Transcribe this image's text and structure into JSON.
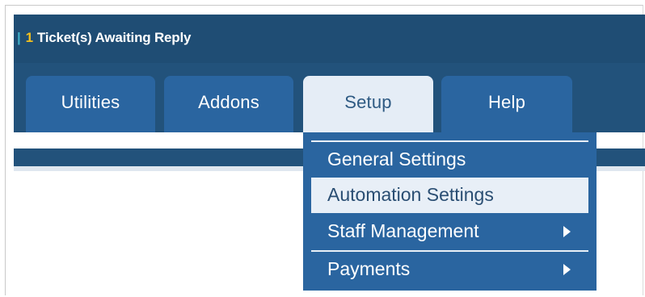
{
  "header": {
    "notice_separator": "|",
    "ticket_count": "1",
    "ticket_label": "Ticket(s) Awaiting Reply"
  },
  "tabs": [
    {
      "label": "Utilities",
      "active": false
    },
    {
      "label": "Addons",
      "active": false
    },
    {
      "label": "Setup",
      "active": true
    },
    {
      "label": "Help",
      "active": false
    }
  ],
  "setup_menu": {
    "items": [
      {
        "label": "General Settings",
        "has_submenu": false,
        "highlighted": false
      },
      {
        "label": "Automation Settings",
        "has_submenu": false,
        "highlighted": true
      },
      {
        "label": "Staff Management",
        "has_submenu": true,
        "highlighted": false
      },
      {
        "label": "Payments",
        "has_submenu": true,
        "highlighted": false
      }
    ],
    "submenu_icon": "triangle-right-icon"
  },
  "colors": {
    "nav_background": "#22527b",
    "tab_background": "#2a65a0",
    "active_tab_background": "#e5edf6",
    "ticket_count": "#f3c01e",
    "highlight_background": "#e8eff7"
  }
}
